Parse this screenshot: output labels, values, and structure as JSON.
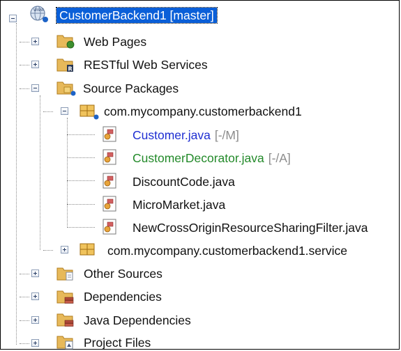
{
  "tree": {
    "root": {
      "label": "CustomerBackend1 [master]",
      "icon": "web-project-icon",
      "expanded": true,
      "selected": true
    },
    "nodes": [
      {
        "id": "web-pages",
        "label": "Web Pages",
        "icon": "web-pages-folder-icon",
        "expanded": false
      },
      {
        "id": "restful",
        "label": "RESTful Web Services",
        "icon": "rest-folder-icon",
        "expanded": false
      },
      {
        "id": "source-packages",
        "label": "Source Packages",
        "icon": "source-packages-folder-icon",
        "expanded": true
      },
      {
        "id": "package-main",
        "label": "com.mycompany.customerbackend1",
        "icon": "package-icon",
        "expanded": true
      },
      {
        "id": "file-customer",
        "label": "Customer.java",
        "suffix": "[-/M]",
        "status": "modified",
        "color": "#1f2fd2",
        "icon": "java-file-icon"
      },
      {
        "id": "file-decorator",
        "label": "CustomerDecorator.java",
        "suffix": "[-/A]",
        "status": "added",
        "color": "#238a2a",
        "icon": "java-file-icon"
      },
      {
        "id": "file-discount",
        "label": "DiscountCode.java",
        "icon": "java-file-icon"
      },
      {
        "id": "file-micromarket",
        "label": "MicroMarket.java",
        "icon": "java-file-icon"
      },
      {
        "id": "file-cors",
        "label": "NewCrossOriginResourceSharingFilter.java",
        "icon": "java-file-icon"
      },
      {
        "id": "package-service",
        "label": "com.mycompany.customerbackend1.service",
        "icon": "package-icon",
        "expanded": false
      },
      {
        "id": "other-sources",
        "label": "Other Sources",
        "icon": "other-sources-folder-icon",
        "expanded": false
      },
      {
        "id": "dependencies",
        "label": "Dependencies",
        "icon": "dependencies-folder-icon",
        "expanded": false
      },
      {
        "id": "java-dependencies",
        "label": "Java Dependencies",
        "icon": "java-dependencies-folder-icon",
        "expanded": false
      },
      {
        "id": "project-files",
        "label": "Project Files",
        "icon": "project-files-folder-icon",
        "expanded": false
      }
    ]
  }
}
